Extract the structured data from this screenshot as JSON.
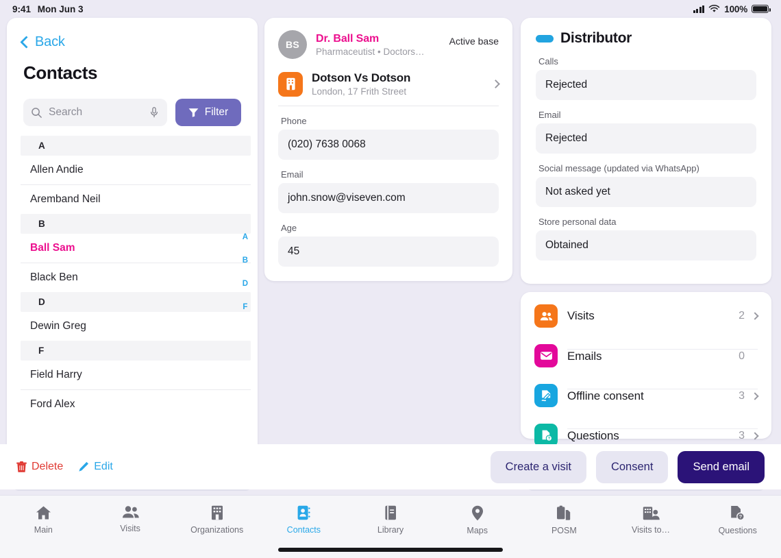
{
  "status_bar": {
    "time": "9:41",
    "date": "Mon Jun 3",
    "battery_percent": "100%",
    "icons": {
      "cellular": "signal-bars-icon",
      "wifi": "wifi-icon",
      "battery": "battery-icon"
    }
  },
  "left_panel": {
    "back_label": "Back",
    "title": "Contacts",
    "search": {
      "placeholder": "Search",
      "value": ""
    },
    "filter_label": "Filter",
    "sections": [
      {
        "letter": "A",
        "items": [
          "Allen Andie",
          "Aremband Neil"
        ]
      },
      {
        "letter": "B",
        "items": [
          "Ball Sam",
          "Black Ben"
        ]
      },
      {
        "letter": "D",
        "items": [
          "Dewin Greg"
        ]
      },
      {
        "letter": "F",
        "items": [
          "Field Harry",
          "Ford Alex"
        ]
      }
    ],
    "selected_contact": "Ball Sam",
    "alpha_index": [
      "A",
      "B",
      "D",
      "F"
    ],
    "accent_selected": "#ec0f8e",
    "accent_index": "#2aa7e8"
  },
  "contact_card": {
    "avatar_initials": "BS",
    "name": "Dr. Ball Sam",
    "subtitle": "Pharmaceutist • Doctors…",
    "status": "Active base",
    "organization": {
      "name": "Dotson Vs Dotson",
      "address": "London, 17 Frith Street",
      "icon": "building-icon",
      "icon_color": "#f5761a"
    },
    "fields": [
      {
        "label": "Phone",
        "value": "(020) 7638 0068"
      },
      {
        "label": "Email",
        "value": "john.snow@viseven.com"
      },
      {
        "label": "Age",
        "value": "45"
      }
    ]
  },
  "distributor": {
    "title": "Distributor",
    "pill_color": "#22a4e0",
    "fields": [
      {
        "label": "Calls",
        "value": "Rejected"
      },
      {
        "label": "Email",
        "value": "Rejected"
      },
      {
        "label": "Social message (updated via WhatsApp)",
        "value": "Not asked yet"
      },
      {
        "label": "Store personal data",
        "value": "Obtained"
      }
    ]
  },
  "activity": {
    "rows": [
      {
        "label": "Visits",
        "count": "2",
        "icon": "people-icon",
        "color": "#f5761a",
        "has_chevron": true
      },
      {
        "label": "Emails",
        "count": "0",
        "icon": "envelope-icon",
        "color": "#e3089a",
        "has_chevron": false
      },
      {
        "label": "Offline consent",
        "count": "3",
        "icon": "signature-icon",
        "color": "#18a6e0",
        "has_chevron": true
      },
      {
        "label": "Questions",
        "count": "3",
        "icon": "question-doc-icon",
        "color": "#0cb9a5",
        "has_chevron": true
      }
    ]
  },
  "bottom_bar": {
    "delete_label": "Delete",
    "edit_label": "Edit",
    "buttons": [
      {
        "label": "Create a visit",
        "style": "secondary"
      },
      {
        "label": "Consent",
        "style": "secondary"
      },
      {
        "label": "Send email",
        "style": "primary"
      }
    ],
    "primary_color": "#2b1378",
    "secondary_color": "#e7e6f2"
  },
  "tab_bar": {
    "active": "Contacts",
    "tabs": [
      {
        "label": "Main",
        "icon": "home-icon"
      },
      {
        "label": "Visits",
        "icon": "people-icon"
      },
      {
        "label": "Organizations",
        "icon": "building-icon"
      },
      {
        "label": "Contacts",
        "icon": "contact-card-icon"
      },
      {
        "label": "Library",
        "icon": "book-icon"
      },
      {
        "label": "Maps",
        "icon": "map-pin-icon"
      },
      {
        "label": "POSM",
        "icon": "posm-icon"
      },
      {
        "label": "Visits to…",
        "icon": "building-person-icon"
      },
      {
        "label": "Questions",
        "icon": "question-doc-icon"
      }
    ],
    "active_color": "#29a8e8",
    "inactive_color": "#6f6f78"
  }
}
